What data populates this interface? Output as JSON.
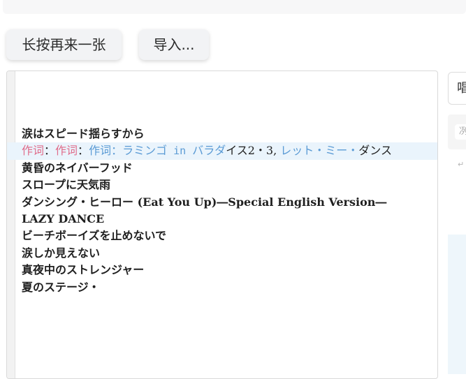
{
  "toolbar": {
    "longpress_label": "长按再来一张",
    "import_label": "导入..."
  },
  "editor": {
    "lines": [
      {
        "text": "涙はスピード揺らすから"
      },
      {
        "p1": "作词",
        "s1": "：",
        "p2": "作词",
        "s2": "：",
        "b1": "作词：ラミンゴ",
        "b2": " in ",
        "b3": "バラダ",
        "d1": "イス2・3,",
        "b4": " レット・ミー・",
        "d2": "ダンス"
      },
      {
        "text": "黄昏のネイバーフッド"
      },
      {
        "text": "スロープに天気雨"
      },
      {
        "text": "ダンシング・ヒーロー (Eat You Up)―Special English Version―"
      },
      {
        "text": "LAZY DANCE"
      },
      {
        "text": "ビーチボーイズを止めないで"
      },
      {
        "text": "涙しか見えない"
      },
      {
        "text": "真夜中のストレンジャー"
      },
      {
        "text": "夏のステージ・"
      }
    ]
  },
  "side": {
    "input_text": "唱",
    "card_text": "冽",
    "return_glyph": "↵"
  }
}
